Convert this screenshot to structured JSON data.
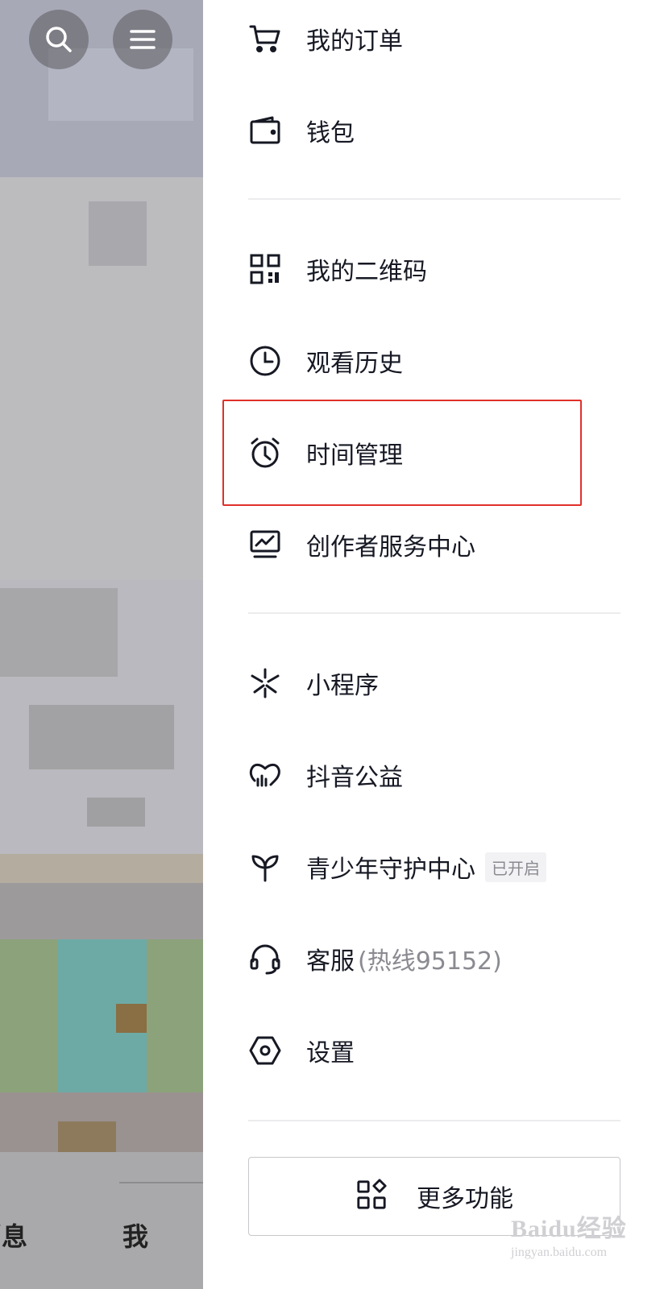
{
  "left_panel": {
    "search_icon": "search-icon",
    "menu_icon": "hamburger-menu-icon",
    "bottom_nav": {
      "messages_partial": "消息",
      "me": "我"
    }
  },
  "menu": {
    "orders": {
      "label": "我的订单",
      "icon": "cart-icon"
    },
    "wallet": {
      "label": "钱包",
      "icon": "wallet-icon"
    },
    "qrcode": {
      "label": "我的二维码",
      "icon": "qrcode-icon"
    },
    "history": {
      "label": "观看历史",
      "icon": "clock-icon"
    },
    "time_mgmt": {
      "label": "时间管理",
      "icon": "alarm-clock-icon"
    },
    "creator": {
      "label": "创作者服务中心",
      "icon": "monitor-chart-icon"
    },
    "mini_programs": {
      "label": "小程序",
      "icon": "asterisk-icon"
    },
    "charity": {
      "label": "抖音公益",
      "icon": "heart-chart-icon"
    },
    "youth": {
      "label": "青少年守护中心",
      "icon": "sprout-icon",
      "badge": "已开启"
    },
    "service": {
      "label": "客服",
      "sub": "(热线95152)",
      "icon": "headset-icon"
    },
    "settings": {
      "label": "设置",
      "icon": "hexagon-gear-icon"
    }
  },
  "more_button": {
    "label": "更多功能",
    "icon": "apps-grid-icon"
  },
  "watermark": {
    "main": "Baidu经验",
    "sub": "jingyan.baidu.com"
  },
  "colors": {
    "highlight": "#e0302a",
    "text": "#161823",
    "muted": "#8a8b91"
  }
}
